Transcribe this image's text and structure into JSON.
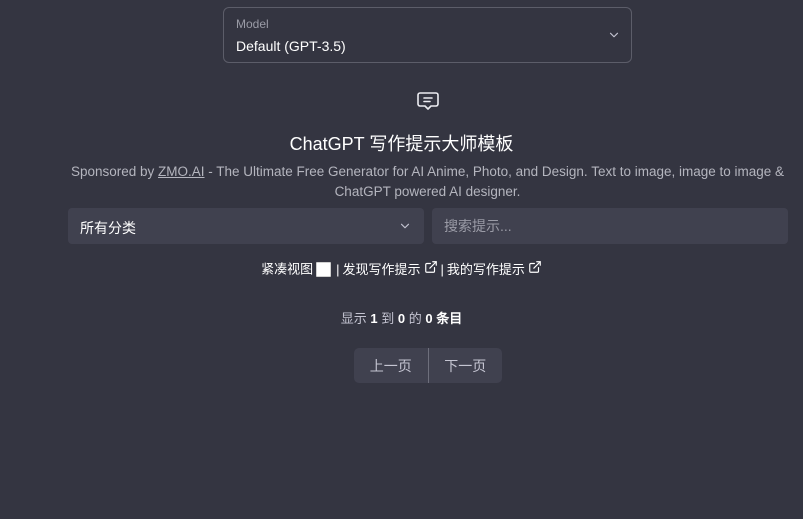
{
  "model": {
    "caption": "Model",
    "value": "Default (GPT-3.5)",
    "icon": "chevron-down-icon"
  },
  "header": {
    "icon": "chat-bubble-icon",
    "title": "ChatGPT 写作提示大师模板"
  },
  "sponsor": {
    "prefix": "Sponsored by ",
    "link_text": "ZMO.AI",
    "suffix": " - The Ultimate Free Generator for AI Anime, Photo, and Design. Text to image, image to image & ChatGPT powered AI designer."
  },
  "filters": {
    "category_value": "所有分类",
    "search_placeholder": "搜索提示..."
  },
  "links": {
    "compact_view_label": "紧凑视图",
    "separator": "|",
    "discover_label": "发现写作提示",
    "my_prompts_label": "我的写作提示",
    "external_icon": "external-link-icon"
  },
  "count": {
    "prefix": "显示 ",
    "from": "1",
    "to_word": " 到 ",
    "to": "0",
    "of_word": " 的 ",
    "total": "0",
    "unit": " 条目"
  },
  "pager": {
    "prev_label": "上一页",
    "next_label": "下一页"
  },
  "colors": {
    "background": "#343541",
    "input_background": "#40414f",
    "text": "#ffffff",
    "muted_text": "#b4b5be"
  }
}
